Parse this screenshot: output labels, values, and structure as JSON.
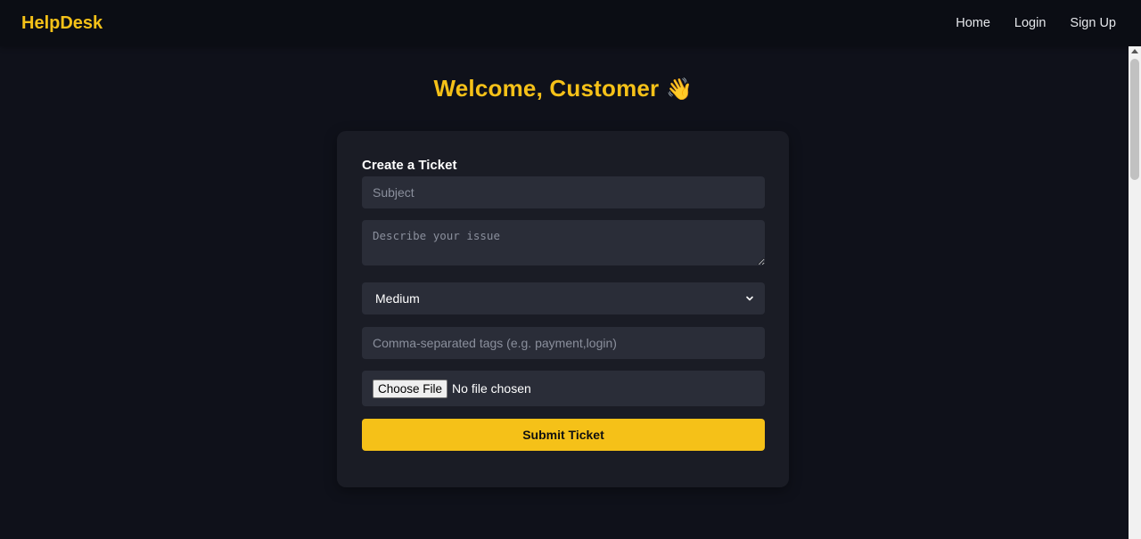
{
  "navbar": {
    "brand": "HelpDesk",
    "links": [
      "Home",
      "Login",
      "Sign Up"
    ]
  },
  "heading": {
    "text": "Welcome, Customer",
    "emoji": "👋"
  },
  "form": {
    "title": "Create a Ticket",
    "subject_placeholder": "Subject",
    "description_placeholder": "Describe your issue",
    "priority_selected": "Medium",
    "tags_placeholder": "Comma-separated tags (e.g. payment,login)",
    "file_button_label": "Choose File",
    "file_status": "No file chosen",
    "submit_label": "Submit Ticket"
  },
  "colors": {
    "accent": "#f5c118",
    "background": "#0f111a",
    "card": "#1a1c25",
    "input": "#2a2d38"
  },
  "icons": {
    "select_arrow": "chevron-down-icon"
  }
}
